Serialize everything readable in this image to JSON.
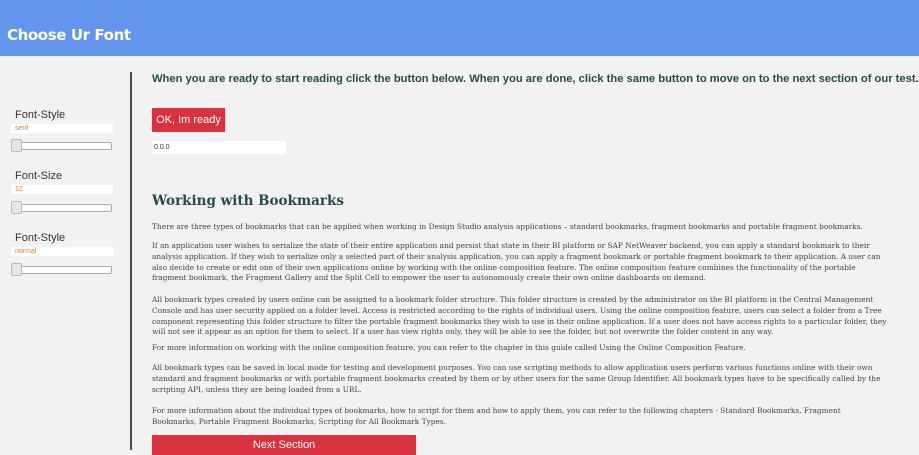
{
  "app": {
    "title": "Choose Ur Font"
  },
  "sidebar": {
    "controls": [
      {
        "label": "Font-Style",
        "value": "serif",
        "slider_level": 0
      },
      {
        "label": "Font-Size",
        "value": "12",
        "slider_level": 0
      },
      {
        "label": "Font-Style",
        "value": "normal",
        "slider_level": 0
      }
    ]
  },
  "main": {
    "instruction": "When you are ready to start reading click the button below. When you are done, click the same button to move on to the next section of our test.",
    "ready_button": "OK, Im ready",
    "timer_value": "0.0.0",
    "article_title": "Working with Bookmarks",
    "paragraphs": [
      "There are three types of bookmarks that can be applied when working in Design Studio analysis applications – standard bookmarks, fragment bookmarks and portable fragment bookmarks.",
      "If an application user wishes to serialize the state of their entire application and persist that state in their BI platform or SAP NetWeaver backend, you can apply a standard bookmark to their analysis application. If they wish to serialize only a selected part of their analysis application, you can apply a fragment bookmark or portable fragment bookmark to their application. A user can also decide to create or edit one of their own applications online by working with the online composition feature. The online composition feature combines the functionality of the portable fragment bookmark, the Fragment Gallery and the Split Cell to empower the user to autonomously create their own online dashboards on demand.",
      "All bookmark types created by users online can be assigned to a bookmark folder structure. This folder structure is created by the administrator on the BI platform in the Central Management Console and has user security applied on a folder level. Access is restricted according to the rights of individual users. Using the online composition feature, users can select a folder from a Tree component representing this folder structure to filter the portable fragment bookmarks they wish to use in their online application. If a user does not have access rights to a particular folder, they will not see it appear as an option for them to select. If a user has view rights only, they will be able to see the folder, but not overwrite the folder content in any way.",
      "For more information on working with the online composition feature, you can refer to the chapter in this guide called Using the Online Composition Feature.",
      "All bookmark types can be saved in local mode for testing and development purposes. You can use scripting methods to allow application users perform various functions online with their own standard and fragment bookmarks or with portable fragment bookmarks created by them or by other users for the same Group Identifier. All bookmark types have to be specifically called by the scripting API, unless they are being loaded from a URL.",
      "For more information about the individual types of bookmarks, how to script for them and how to apply them, you can refer to the following chapters - Standard Bookmarks, Fragment Bookmarks, Portable Fragment Bookmarks, Scripting for All Bookmark Types."
    ],
    "next_button": "Next Section"
  },
  "colors": {
    "header": "#6495ed",
    "accent_button": "#d9323f",
    "value_text": "#e67e22",
    "heading_text": "#2a4a4a"
  }
}
